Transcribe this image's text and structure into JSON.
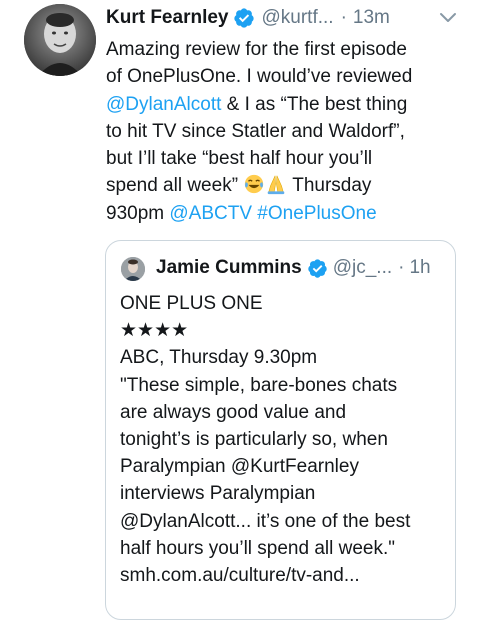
{
  "tweet": {
    "author_name": "Kurt Fearnley",
    "handle": "@kurtf...",
    "separator": "·",
    "time": "13m",
    "lines": [
      [
        {
          "t": "Amazing review for the first episode"
        }
      ],
      [
        {
          "t": "of OnePlusOne. I would’ve reviewed"
        }
      ],
      [
        {
          "t": "@DylanAlcott",
          "link": true
        },
        {
          "t": " & I as “The best thing"
        }
      ],
      [
        {
          "t": "to hit TV since Statler and Waldorf”,"
        }
      ],
      [
        {
          "t": "but I’ll take “best half hour you’ll"
        }
      ],
      [
        {
          "t": "spend all week” "
        },
        {
          "emoji": "tears-of-joy-emoji"
        },
        {
          "emoji": "folded-hands-emoji"
        },
        {
          "t": " Thursday"
        }
      ],
      [
        {
          "t": "930pm "
        },
        {
          "t": "@ABCTV",
          "link": true
        },
        {
          "t": "  "
        },
        {
          "t": "#OnePlusOne",
          "link": true
        }
      ]
    ]
  },
  "quoted_tweet": {
    "author_name": "Jamie Cummins",
    "handle": "@jc_...",
    "separator": "·",
    "time": "1h",
    "lines": [
      "ONE PLUS ONE",
      "★★★★",
      "ABC, Thursday 9.30pm",
      "\"These simple, bare-bones chats",
      "are always good value and",
      "tonight’s is particularly so, when",
      "Paralympian @KurtFearnley",
      "interviews Paralympian",
      "@DylanAlcott... it’s one of the best",
      "half hours you’ll spend all week.\"",
      "smh.com.au/culture/tv-and..."
    ]
  },
  "colors": {
    "link": "#1da1f2",
    "verified": "#1da1f2",
    "secondary_text": "#657786",
    "border": "#ccd6dd"
  },
  "icons": {
    "verified": "verified-badge-icon",
    "menu": "chevron-down-icon"
  }
}
